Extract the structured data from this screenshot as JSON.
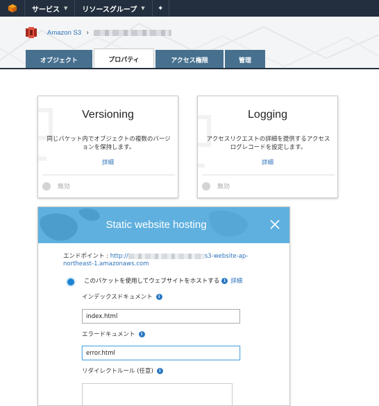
{
  "topnav": {
    "services_label": "サービス",
    "resource_groups_label": "リソースグループ",
    "pin_glyph": "✦"
  },
  "breadcrumb": {
    "root": "Amazon S3",
    "separator": "›"
  },
  "tabs": [
    {
      "label": "オブジェクト",
      "active": false
    },
    {
      "label": "プロパティ",
      "active": true
    },
    {
      "label": "アクセス権限",
      "active": false
    },
    {
      "label": "管理",
      "active": false
    }
  ],
  "cards": {
    "versioning": {
      "title": "Versioning",
      "description": "同じバケット内でオブジェクトの複数のバージョンを保持します。",
      "link": "詳細",
      "status": "無効"
    },
    "logging": {
      "title": "Logging",
      "description": "アクセスリクエストの詳細を提供するアクセスログレコードを設定します。",
      "link": "詳細",
      "status": "無効"
    }
  },
  "hosting": {
    "title": "Static website hosting",
    "endpoint_label": "エンドポイント : ",
    "endpoint_prefix": "http://",
    "endpoint_suffix": "s3-website-ap-northeast-1.amazonaws.com",
    "option_label": "このバケットを使用してウェブサイトをホストする",
    "option_link": "詳細",
    "index_label": "インデックスドキュメント",
    "index_value": "index.html",
    "error_label": "エラードキュメント",
    "error_value": "error.html",
    "redirect_label": "リダイレクトルール (任意)"
  },
  "colors": {
    "nav_bg": "#232f3e",
    "tab_bg": "#47708f",
    "panel_header": "#5fb0de",
    "link": "#2b71b8",
    "radio": "#1b84d3"
  },
  "icons": {
    "logo": "aws-cube-icon",
    "s3": "s3-bucket-icon",
    "close": "close-icon",
    "info": "info-icon"
  }
}
